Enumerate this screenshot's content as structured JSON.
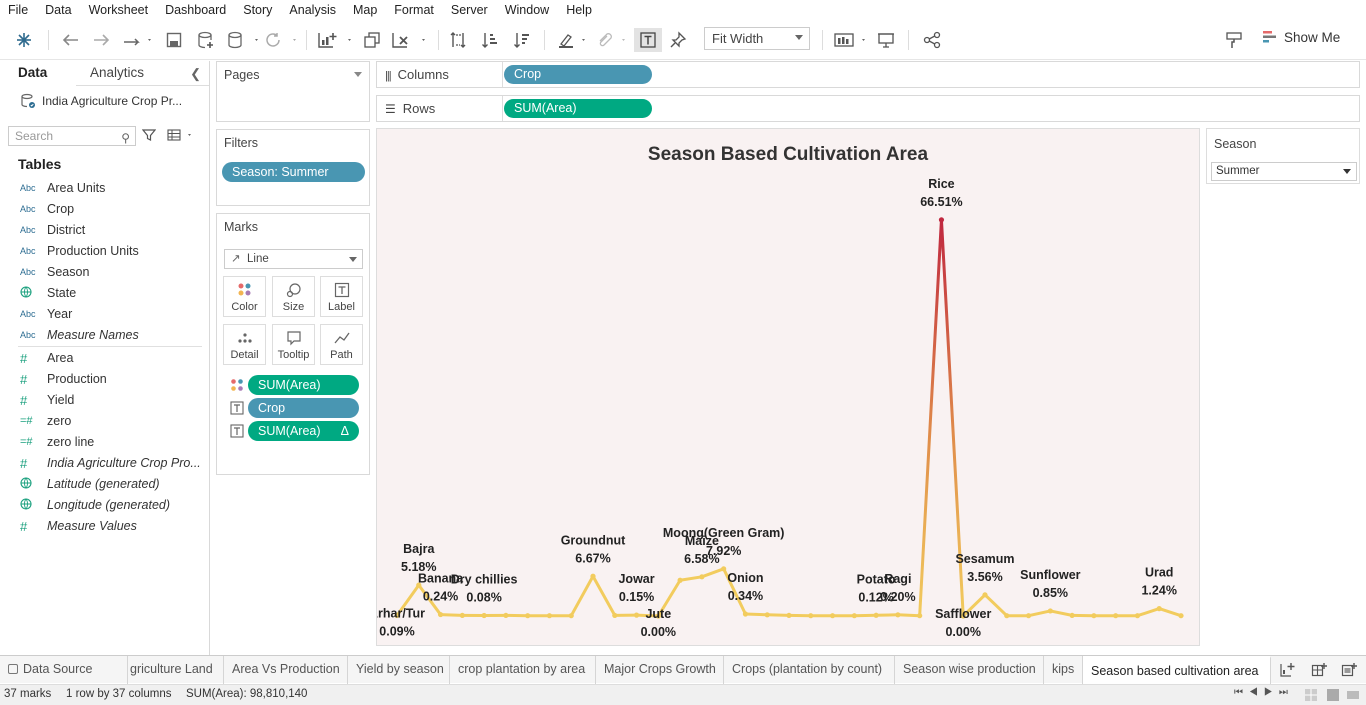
{
  "menu": [
    "File",
    "Data",
    "Worksheet",
    "Dashboard",
    "Story",
    "Analysis",
    "Map",
    "Format",
    "Server",
    "Window",
    "Help"
  ],
  "toolbar": {
    "fit": "Fit Width",
    "show_me": "Show Me"
  },
  "sidebar": {
    "tab_data": "Data",
    "tab_analytics": "Analytics",
    "datasource": "India Agriculture Crop Pr...",
    "search_placeholder": "Search",
    "tables_heading": "Tables",
    "fields": [
      {
        "type": "Abc",
        "name": "Area Units"
      },
      {
        "type": "Abc",
        "name": "Crop"
      },
      {
        "type": "Abc",
        "name": "District"
      },
      {
        "type": "Abc",
        "name": "Production Units"
      },
      {
        "type": "Abc",
        "name": "Season"
      },
      {
        "type": "geo",
        "name": "State"
      },
      {
        "type": "Abc",
        "name": "Year"
      },
      {
        "type": "Abc",
        "name": "Measure Names",
        "italic": true
      },
      {
        "type": "#",
        "name": "Area"
      },
      {
        "type": "#",
        "name": "Production"
      },
      {
        "type": "#",
        "name": "Yield"
      },
      {
        "type": "=#",
        "name": "zero"
      },
      {
        "type": "=#",
        "name": "zero line"
      },
      {
        "type": "#",
        "name": "India Agriculture Crop Pro...",
        "italic": true
      },
      {
        "type": "geo",
        "name": "Latitude (generated)",
        "italic": true
      },
      {
        "type": "geo",
        "name": "Longitude (generated)",
        "italic": true
      },
      {
        "type": "#",
        "name": "Measure Values",
        "italic": true
      }
    ]
  },
  "pages": {
    "title": "Pages"
  },
  "filters": {
    "title": "Filters",
    "pill": "Season: Summer"
  },
  "marks": {
    "title": "Marks",
    "type": "Line",
    "buttons": [
      "Color",
      "Size",
      "Label",
      "Detail",
      "Tooltip",
      "Path"
    ],
    "pills": [
      "SUM(Area)",
      "Crop",
      "SUM(Area)"
    ],
    "delta": "Δ"
  },
  "shelves": {
    "columns_label": "Columns",
    "columns_pill": "Crop",
    "rows_label": "Rows",
    "rows_pill": "SUM(Area)"
  },
  "viz": {
    "title": "Season Based Cultivation Area"
  },
  "legend": {
    "title": "Season",
    "value": "Summer"
  },
  "chart_data": {
    "type": "line",
    "title": "Season Based Cultivation Area",
    "xlabel": "",
    "ylabel": "",
    "ylim": [
      0,
      70
    ],
    "points": [
      {
        "crop": "Arhar/Tur",
        "pct": 0.09,
        "label": "0.09%"
      },
      {
        "crop": "Bajra",
        "pct": 5.18,
        "label": "5.18%"
      },
      {
        "crop": "Banana",
        "pct": 0.24,
        "label": "0.24%"
      },
      {
        "crop": "",
        "pct": 0.1
      },
      {
        "crop": "Dry chillies",
        "pct": 0.08,
        "label": "0.08%"
      },
      {
        "crop": "",
        "pct": 0.1
      },
      {
        "crop": "",
        "pct": 0.05
      },
      {
        "crop": "",
        "pct": 0.05
      },
      {
        "crop": "",
        "pct": 0.05
      },
      {
        "crop": "Groundnut",
        "pct": 6.67,
        "label": "6.67%"
      },
      {
        "crop": "",
        "pct": 0.1
      },
      {
        "crop": "Jowar",
        "pct": 0.15,
        "label": "0.15%"
      },
      {
        "crop": "Jute",
        "pct": 0.0,
        "label": "0.00%"
      },
      {
        "crop": "",
        "pct": 6.0
      },
      {
        "crop": "Maize",
        "pct": 6.58,
        "label": "6.58%"
      },
      {
        "crop": "Moong(Green Gram)",
        "pct": 7.92,
        "label": "7.92%"
      },
      {
        "crop": "Onion",
        "pct": 0.34,
        "label": "0.34%"
      },
      {
        "crop": "",
        "pct": 0.2
      },
      {
        "crop": "",
        "pct": 0.1
      },
      {
        "crop": "",
        "pct": 0.05
      },
      {
        "crop": "",
        "pct": 0.05
      },
      {
        "crop": "",
        "pct": 0.05
      },
      {
        "crop": "Potato",
        "pct": 0.12,
        "label": "0.12%"
      },
      {
        "crop": "Ragi",
        "pct": 0.2,
        "label": "0.20%"
      },
      {
        "crop": "",
        "pct": 0.05
      },
      {
        "crop": "Rice",
        "pct": 66.51,
        "label": "66.51%"
      },
      {
        "crop": "Safflower",
        "pct": 0.0,
        "label": "0.00%"
      },
      {
        "crop": "Sesamum",
        "pct": 3.56,
        "label": "3.56%"
      },
      {
        "crop": "",
        "pct": 0.05
      },
      {
        "crop": "",
        "pct": 0.05
      },
      {
        "crop": "Sunflower",
        "pct": 0.85,
        "label": "0.85%"
      },
      {
        "crop": "",
        "pct": 0.1
      },
      {
        "crop": "",
        "pct": 0.05
      },
      {
        "crop": "",
        "pct": 0.05
      },
      {
        "crop": "",
        "pct": 0.05
      },
      {
        "crop": "Urad",
        "pct": 1.24,
        "label": "1.24%"
      },
      {
        "crop": "",
        "pct": 0.05
      }
    ],
    "colors": {
      "low": "#f2cc5e",
      "mid": "#e08d4a",
      "high": "#c0283f"
    }
  },
  "tabs": [
    "Data Source",
    "griculture Land",
    "Area Vs Production",
    "Yield by season",
    "crop plantation by area",
    "Major Crops Growth",
    "Crops (plantation by count)",
    "Season wise production",
    "kips",
    "Season based cultivation area"
  ],
  "status": {
    "marks": "37 marks",
    "shape": "1 row by 37 columns",
    "sum": "SUM(Area): 98,810,140"
  }
}
